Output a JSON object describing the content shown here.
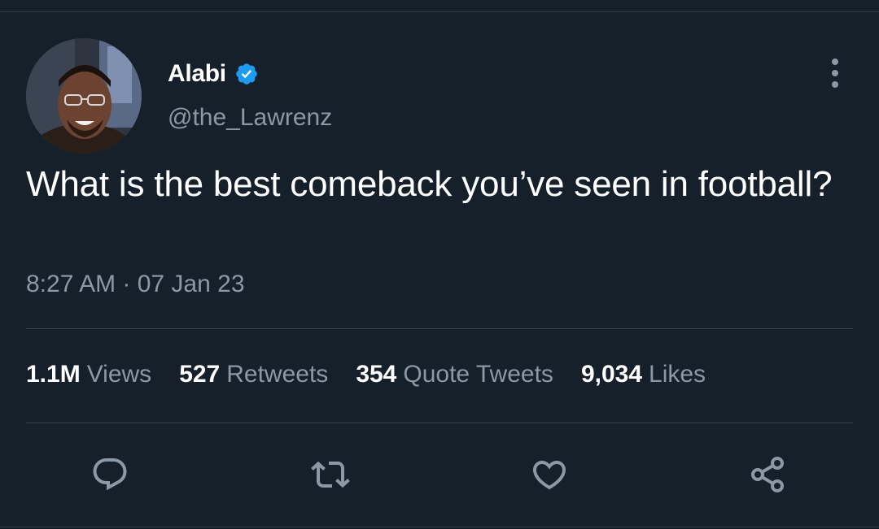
{
  "author": {
    "display_name": "Alabi",
    "verified_icon": "verified-badge-icon",
    "handle": "@the_Lawrenz"
  },
  "tweet": {
    "text": "What is the best comeback you’ve seen in football?",
    "timestamp": "8:27 AM · 07 Jan 23"
  },
  "stats": [
    {
      "value": "1.1M",
      "label": "Views"
    },
    {
      "value": "527",
      "label": "Retweets"
    },
    {
      "value": "354",
      "label": "Quote Tweets"
    },
    {
      "value": "9,034",
      "label": "Likes"
    }
  ],
  "actions": {
    "reply_icon": "reply-icon",
    "retweet_icon": "retweet-icon",
    "like_icon": "heart-icon",
    "share_icon": "share-icon"
  },
  "colors": {
    "background": "#15202b",
    "secondary_text": "#8b98a5",
    "verified": "#1d9bf0",
    "divider": "#38444d"
  }
}
